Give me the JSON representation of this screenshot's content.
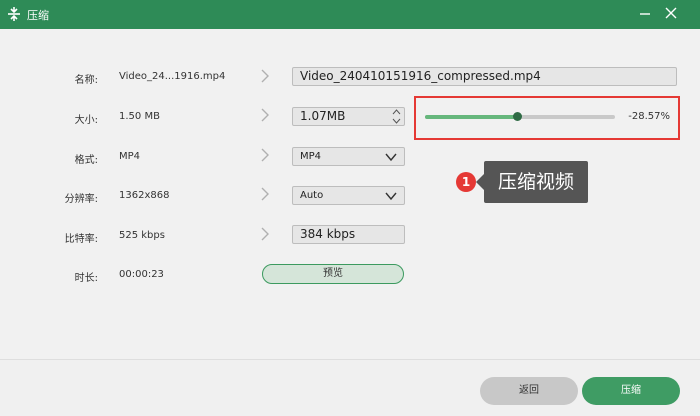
{
  "window": {
    "title": "压缩"
  },
  "rows": [
    {
      "label": "名称:",
      "value": "Video_24...1916.mp4",
      "field": "Video_240410151916_compressed.mp4"
    },
    {
      "label": "大小:",
      "value": "1.50 MB",
      "field": "1.07MB"
    },
    {
      "label": "格式:",
      "value": "MP4",
      "field": "MP4"
    },
    {
      "label": "分辨率:",
      "value": "1362x868",
      "field": "Auto"
    },
    {
      "label": "比特率:",
      "value": "525 kbps",
      "field": "384 kbps"
    },
    {
      "label": "时长:",
      "value": "00:00:23"
    }
  ],
  "preview_button": "预览",
  "compression_slider": {
    "percent_text": "-28.57%",
    "level": 0.485
  },
  "annotation": {
    "number": "1",
    "text": "压缩视频"
  },
  "footer": {
    "back": "返回",
    "compress": "压缩"
  },
  "colors": {
    "titlebar": "#2e8b57",
    "accent": "#3f9c64",
    "highlight_border": "#e53935"
  }
}
